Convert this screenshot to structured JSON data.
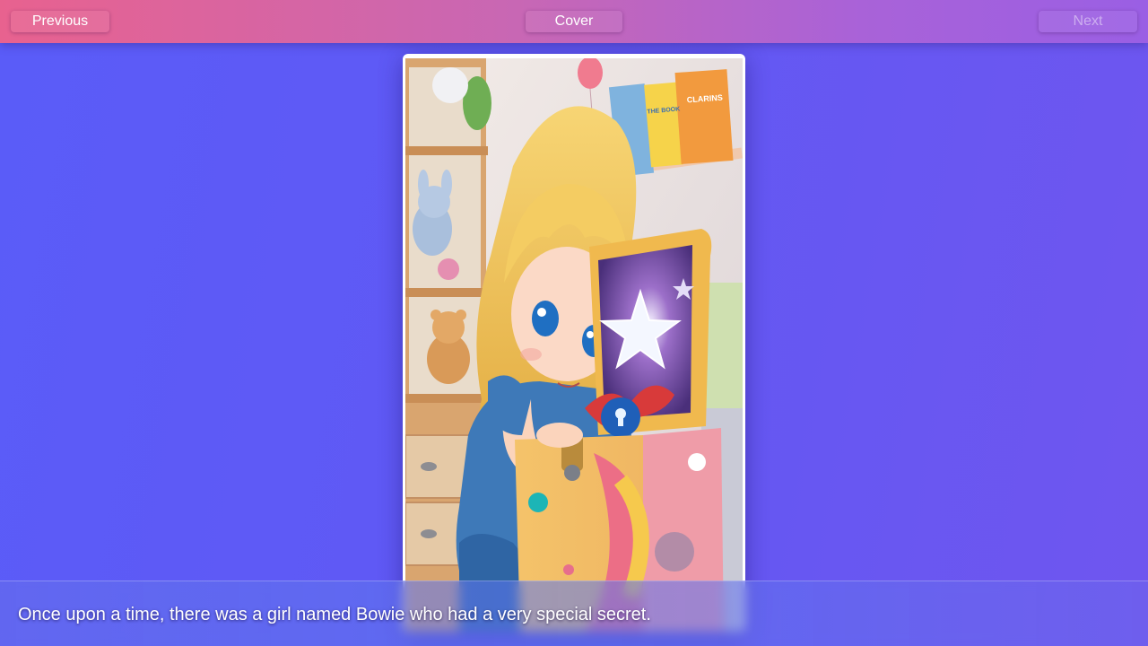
{
  "nav": {
    "previous_label": "Previous",
    "cover_label": "Cover",
    "next_label": "Next"
  },
  "story": {
    "caption": "Once upon a time, there was a girl named Bowie who had a very special secret."
  },
  "illustration": {
    "books": [
      "CLARINS",
      "THE BOOK"
    ]
  },
  "colors": {
    "topbar_start": "#e8628f",
    "topbar_end": "#9a5fe4",
    "background": "#5a5cf8"
  }
}
